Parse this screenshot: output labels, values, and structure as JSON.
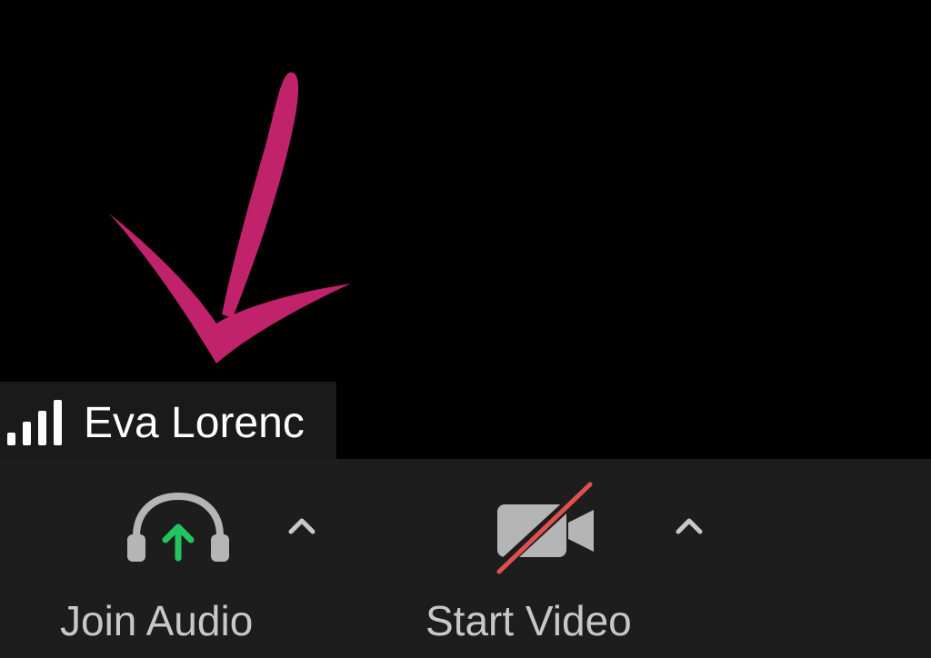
{
  "participant": {
    "name": "Eva Lorenc",
    "signal_icon": "signal-bars-icon"
  },
  "annotation": {
    "icon": "hand-drawn-arrow",
    "color": "#c0226b"
  },
  "toolbar": {
    "join_audio": {
      "label": "Join Audio",
      "icon": "headphones-icon",
      "arrow_color": "#22c55e"
    },
    "start_video": {
      "label": "Start Video",
      "icon": "video-camera-off-icon",
      "slash_color": "#e05050"
    }
  },
  "colors": {
    "background": "#000000",
    "toolbar": "#1d1d1d",
    "name_tag": "#1a1a1a",
    "label": "#c8c8c8",
    "icon_gray": "#b5b5b5"
  }
}
